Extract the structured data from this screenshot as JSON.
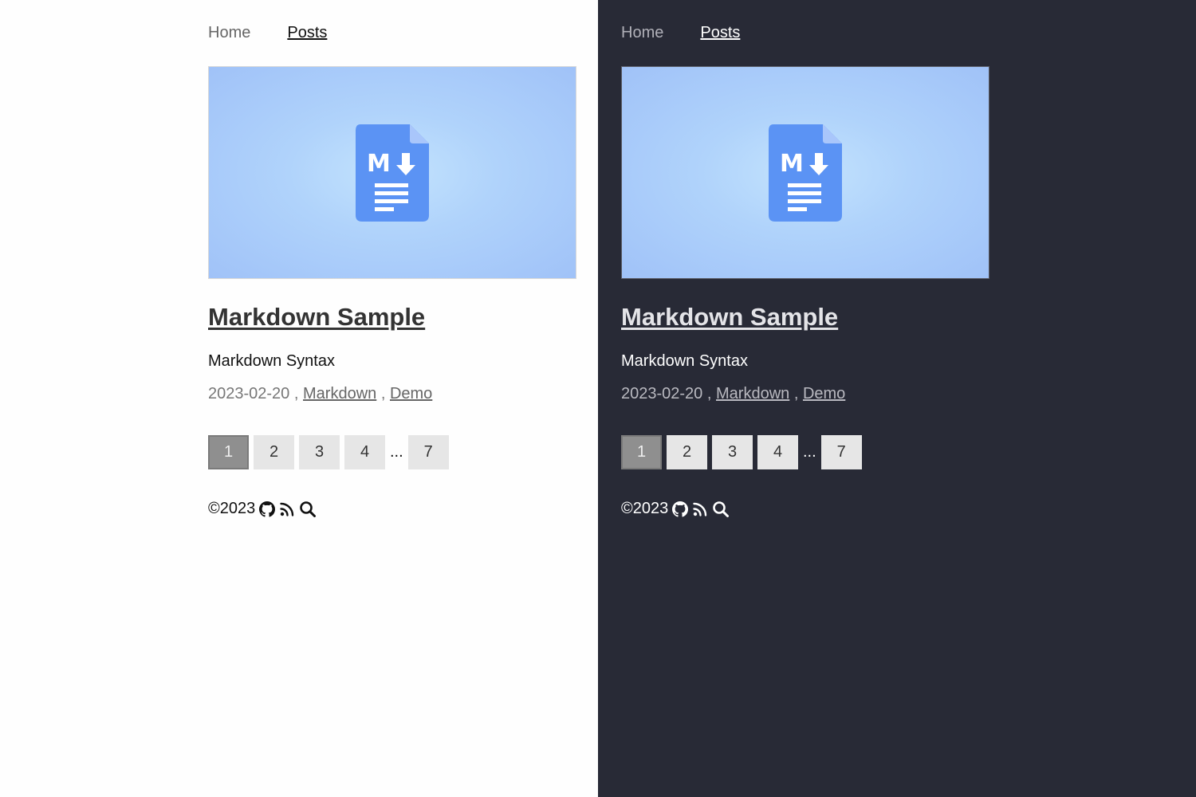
{
  "nav": {
    "home": "Home",
    "posts": "Posts"
  },
  "post": {
    "title": "Markdown Sample",
    "subtitle": "Markdown Syntax",
    "date": "2023-02-20",
    "sep": ",",
    "tags": [
      "Markdown",
      "Demo"
    ],
    "cover_icon": "markdown-file-icon",
    "cover_label": "M"
  },
  "pagination": {
    "pages": [
      "1",
      "2",
      "3",
      "4",
      "7"
    ],
    "current": "1",
    "ellipsis": "..."
  },
  "footer": {
    "copyright": "©2023",
    "icons": [
      "github-icon",
      "rss-icon",
      "search-icon"
    ]
  },
  "colors": {
    "light_bg": "#fefefe",
    "dark_bg": "#282a36",
    "page_btn": "#e6e6e6",
    "page_btn_active": "#8f8f8f",
    "icon_blue": "#5b93f4"
  }
}
